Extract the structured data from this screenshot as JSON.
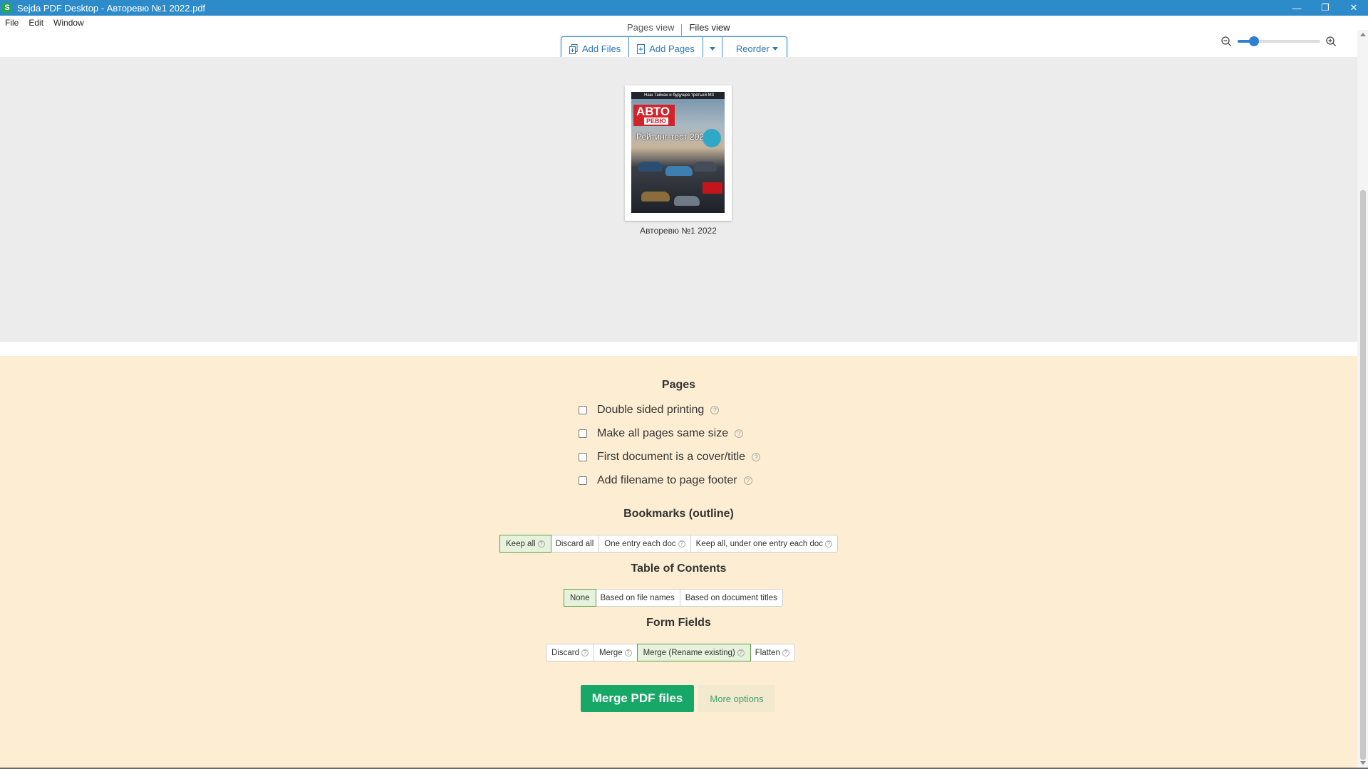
{
  "window": {
    "icon_letter": "S",
    "title": "Sejda PDF Desktop - Авторевю №1 2022.pdf",
    "controls": {
      "minimize": "—",
      "restore": "❐",
      "close": "✕"
    }
  },
  "menu": {
    "items": [
      "File",
      "Edit",
      "Window"
    ]
  },
  "view_tabs": {
    "pages": "Pages view",
    "files": "Files view"
  },
  "toolbar": {
    "add_files": "Add Files",
    "add_pages": "Add Pages",
    "reorder": "Reorder"
  },
  "zoom": {
    "level_fraction": 0.2
  },
  "file": {
    "name": "Авторевю №1 2022",
    "cover": {
      "top_line": "Наш Тайкан и будущее третьей M3",
      "logo": "АВТО",
      "logo_sub": "РЕВЮ",
      "headline": "Рейтинг-тест 2021"
    }
  },
  "options": {
    "pages_title": "Pages",
    "checks": [
      {
        "label": "Double sided printing",
        "checked": false
      },
      {
        "label": "Make all pages same size",
        "checked": false
      },
      {
        "label": "First document is a cover/title",
        "checked": false
      },
      {
        "label": "Add filename to page footer",
        "checked": false
      }
    ],
    "bookmarks_title": "Bookmarks (outline)",
    "bookmarks": [
      {
        "label": "Keep all",
        "selected": true
      },
      {
        "label": "Discard all",
        "selected": false
      },
      {
        "label": "One entry each doc",
        "selected": false
      },
      {
        "label": "Keep all, under one entry each doc",
        "selected": false
      }
    ],
    "toc_title": "Table of Contents",
    "toc": [
      {
        "label": "None",
        "selected": true
      },
      {
        "label": "Based on file names",
        "selected": false
      },
      {
        "label": "Based on document titles",
        "selected": false
      }
    ],
    "form_title": "Form Fields",
    "form": [
      {
        "label": "Discard",
        "selected": false
      },
      {
        "label": "Merge",
        "selected": false
      },
      {
        "label": "Merge (Rename existing)",
        "selected": true
      },
      {
        "label": "Flatten",
        "selected": false
      }
    ],
    "help_glyph": "?"
  },
  "actions": {
    "merge": "Merge PDF files",
    "more": "More options"
  },
  "colors": {
    "titlebar": "#2e8bc9",
    "accent_blue": "#3077b8",
    "merge_green": "#17a867",
    "panel": "#fdeed3"
  }
}
